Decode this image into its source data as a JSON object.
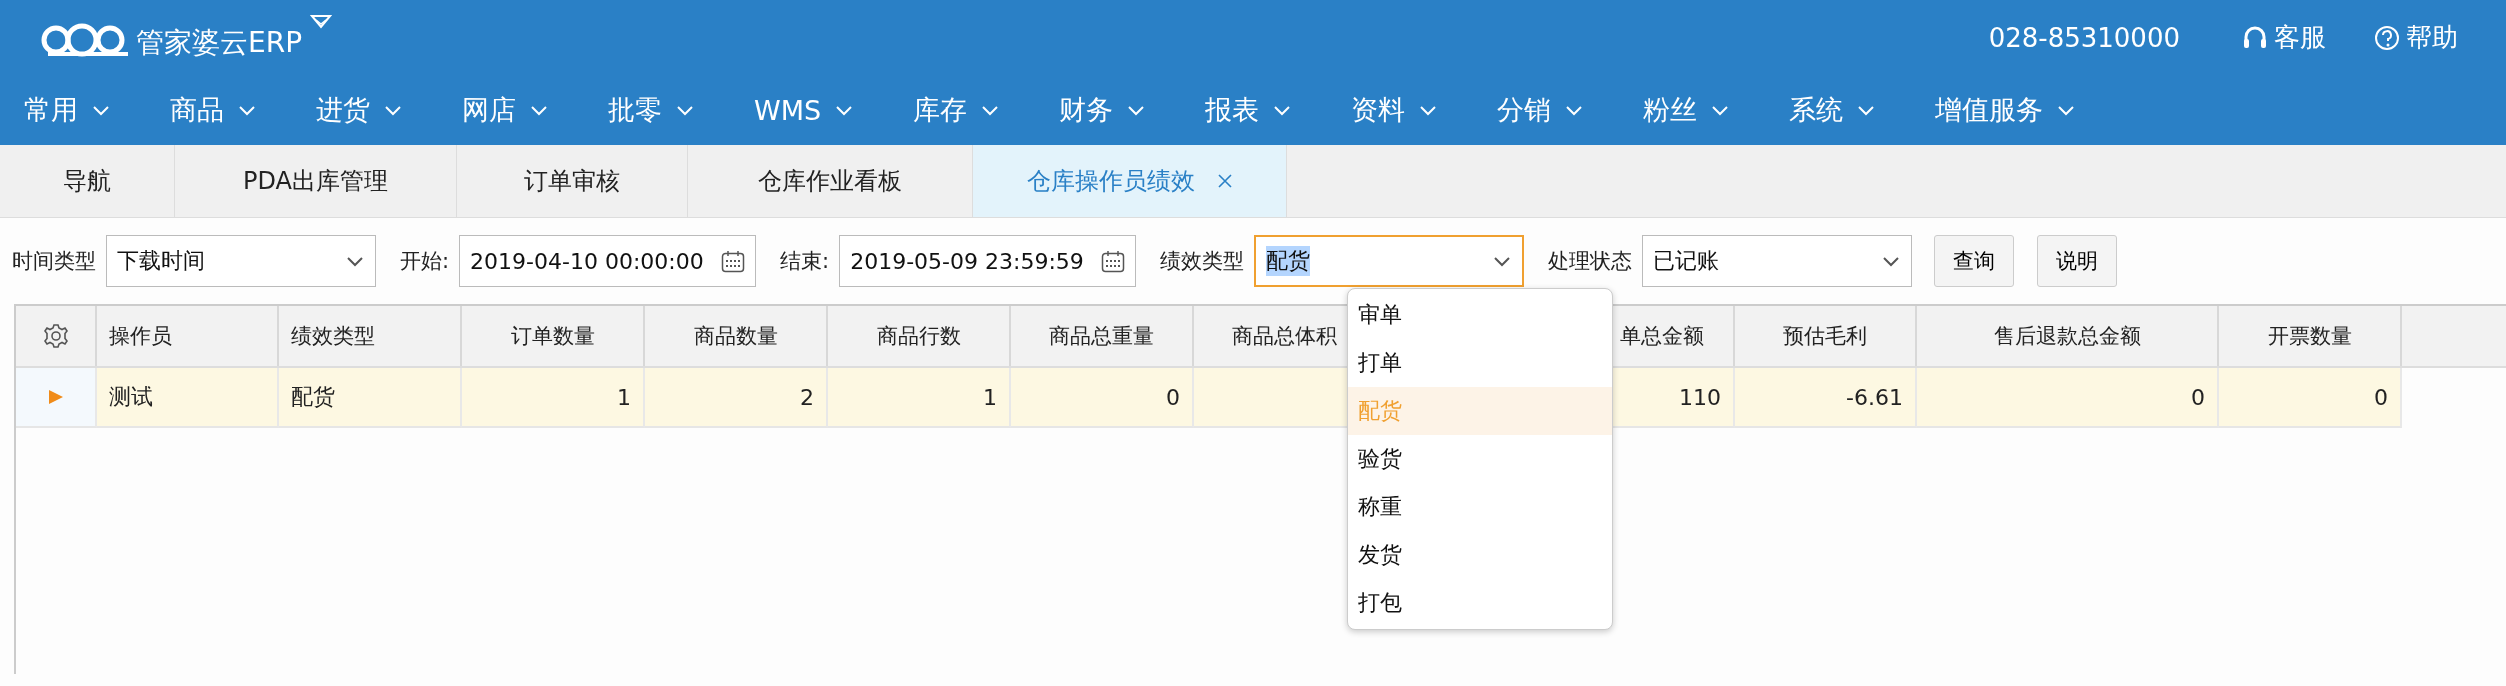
{
  "header": {
    "logo_text": "管家婆云ERP",
    "phone": "028-85310000",
    "links": [
      {
        "kind": "headset",
        "label": "客服"
      },
      {
        "kind": "help",
        "label": "帮助"
      }
    ]
  },
  "nav": [
    {
      "label": "常用"
    },
    {
      "label": "商品"
    },
    {
      "label": "进货"
    },
    {
      "label": "网店"
    },
    {
      "label": "批零"
    },
    {
      "label": "WMS"
    },
    {
      "label": "库存"
    },
    {
      "label": "财务"
    },
    {
      "label": "报表"
    },
    {
      "label": "资料"
    },
    {
      "label": "分销"
    },
    {
      "label": "粉丝"
    },
    {
      "label": "系统"
    },
    {
      "label": "增值服务"
    }
  ],
  "tabs": [
    {
      "label": "导航",
      "selected": false,
      "closable": false
    },
    {
      "label": "PDA出库管理",
      "selected": false,
      "closable": false
    },
    {
      "label": "订单审核",
      "selected": false,
      "closable": false
    },
    {
      "label": "仓库作业看板",
      "selected": false,
      "closable": false
    },
    {
      "label": "仓库操作员绩效",
      "selected": true,
      "closable": true
    }
  ],
  "filters": [
    {
      "kind": "select",
      "label": "时间类型",
      "value": "下载时间",
      "focused": false
    },
    {
      "kind": "date",
      "label": "开始:",
      "value": "2019-04-10 00:00:00"
    },
    {
      "kind": "date",
      "label": "结束:",
      "value": "2019-05-09 23:59:59"
    },
    {
      "kind": "select",
      "label": "绩效类型",
      "value": "配货",
      "focused": true
    },
    {
      "kind": "select",
      "label": "处理状态",
      "value": "已记账",
      "focused": false
    }
  ],
  "buttons": [
    "查询",
    "说明"
  ],
  "dropdown": {
    "items": [
      {
        "label": "审单",
        "selected": false
      },
      {
        "label": "打单",
        "selected": false
      },
      {
        "label": "配货",
        "selected": true
      },
      {
        "label": "验货",
        "selected": false
      },
      {
        "label": "称重",
        "selected": false
      },
      {
        "label": "发货",
        "selected": false
      },
      {
        "label": "打包",
        "selected": false
      }
    ]
  },
  "table": {
    "columns": [
      {
        "label": "操作员",
        "kind": "text"
      },
      {
        "label": "绩效类型",
        "kind": "text"
      },
      {
        "label": "订单数量",
        "kind": "number"
      },
      {
        "label": "商品数量",
        "kind": "number"
      },
      {
        "label": "商品行数",
        "kind": "number"
      },
      {
        "label": "商品总重量",
        "kind": "number"
      },
      {
        "label": "商品总体积",
        "kind": "number"
      },
      {
        "label": "单总金额",
        "kind": "number"
      },
      {
        "label": "预估毛利",
        "kind": "number"
      },
      {
        "label": "售后退款总金额",
        "kind": "number"
      },
      {
        "label": "开票数量",
        "kind": "number"
      }
    ],
    "rows": [
      {
        "current": true,
        "cells": [
          "测试",
          "配货",
          "1",
          "2",
          "1",
          "0",
          null,
          "110",
          "-6.61",
          "0",
          "0"
        ]
      }
    ]
  }
}
